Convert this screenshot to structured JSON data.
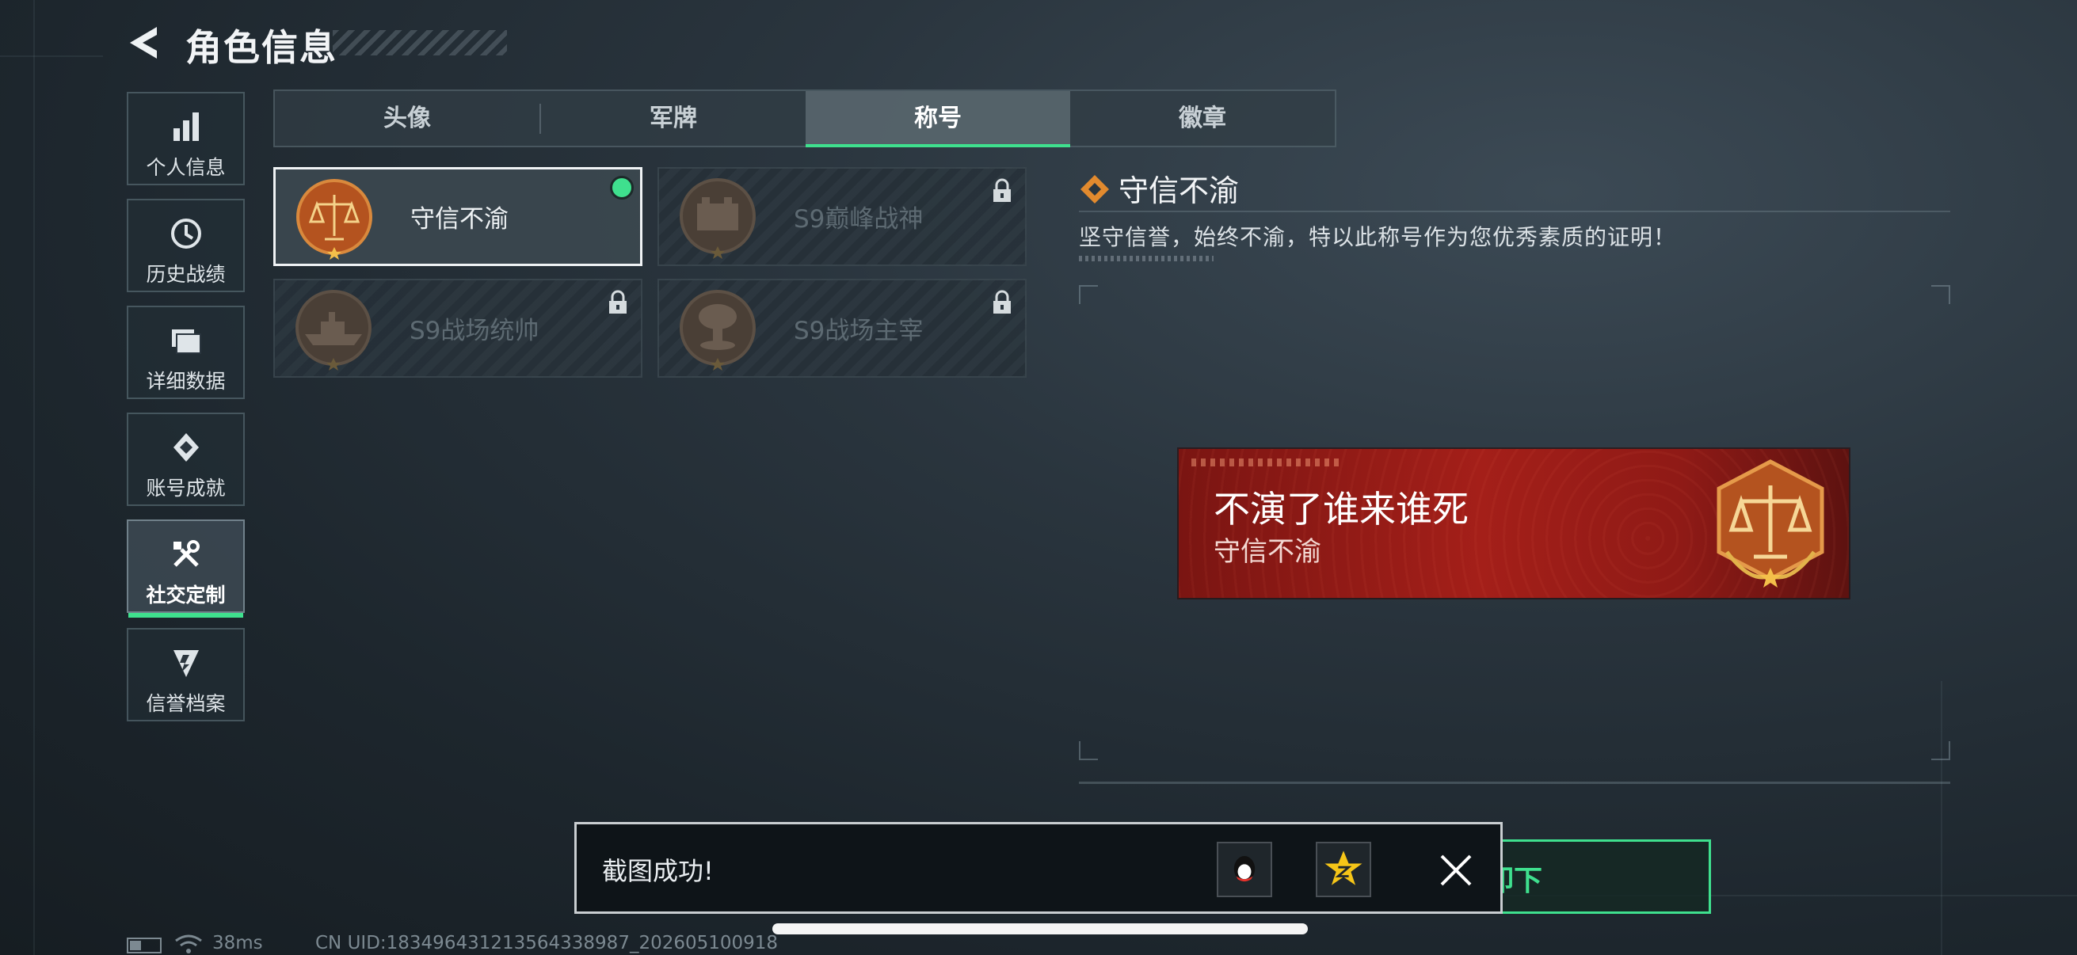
{
  "header": {
    "title": "角色信息"
  },
  "sidebar": {
    "items": [
      {
        "label": "个人信息",
        "icon": "bar-chart-icon",
        "active": false
      },
      {
        "label": "历史战绩",
        "icon": "history-clock-icon",
        "active": false
      },
      {
        "label": "详细数据",
        "icon": "folder-icon",
        "active": false
      },
      {
        "label": "账号成就",
        "icon": "achievement-badge-icon",
        "active": false
      },
      {
        "label": "社交定制",
        "icon": "tools-icon",
        "active": true
      },
      {
        "label": "信誉档案",
        "icon": "reputation-shield-icon",
        "active": false
      }
    ]
  },
  "tabs": [
    {
      "label": "头像",
      "active": false
    },
    {
      "label": "军牌",
      "active": false
    },
    {
      "label": "称号",
      "active": true
    },
    {
      "label": "徽章",
      "active": false
    }
  ],
  "titles": [
    {
      "label": "守信不渝",
      "selected": true,
      "locked": false,
      "equipped": true,
      "icon": "scales-medal-icon"
    },
    {
      "label": "S9巅峰战神",
      "selected": false,
      "locked": true,
      "equipped": false,
      "icon": "fortress-medal-icon"
    },
    {
      "label": "S9战场统帅",
      "selected": false,
      "locked": true,
      "equipped": false,
      "icon": "warship-medal-icon"
    },
    {
      "label": "S9战场主宰",
      "selected": false,
      "locked": true,
      "equipped": false,
      "icon": "mushroom-cloud-medal-icon"
    }
  ],
  "detail": {
    "title": "守信不渝",
    "description": "坚守信誉，始终不渝，特以此称号作为您优秀素质的证明！"
  },
  "banner": {
    "player_name": "不演了谁来谁死",
    "title": "守信不渝"
  },
  "unequip_button": {
    "label": "卸下"
  },
  "toast": {
    "text": "截图成功!"
  },
  "status": {
    "ping": "38ms",
    "uid": "CN UID:183496431213564338987_202605100918"
  },
  "colors": {
    "accent": "#3fe08e",
    "banner": "#a41f19",
    "medal": "#b4531f"
  }
}
